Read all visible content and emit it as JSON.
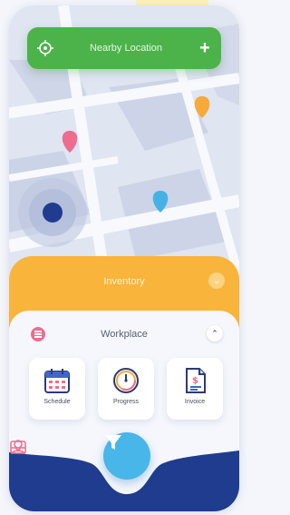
{
  "header": {
    "title": "Nearby Location",
    "add_symbol": "+"
  },
  "sections": {
    "inventory": {
      "label": "Inventory"
    },
    "workplace": {
      "label": "Workplace"
    }
  },
  "cards": [
    {
      "label": "Schedule",
      "icon": "calendar-icon"
    },
    {
      "label": "Progress",
      "icon": "clock-icon"
    },
    {
      "label": "Invoice",
      "icon": "invoice-icon"
    }
  ],
  "nav": {
    "left_icon": "inbox-icon",
    "center_icon": "filter-icon",
    "right_icon": "profile-icon"
  },
  "colors": {
    "header_green": "#4bb34a",
    "inventory_orange": "#f9b43b",
    "nav_blue": "#1f3c8e",
    "filter_blue": "#48b6e8",
    "pin_pink": "#ee6c8e",
    "pin_orange": "#f7a93b",
    "pin_blue": "#45b2e5",
    "user_dot": "#1f3c8e"
  }
}
